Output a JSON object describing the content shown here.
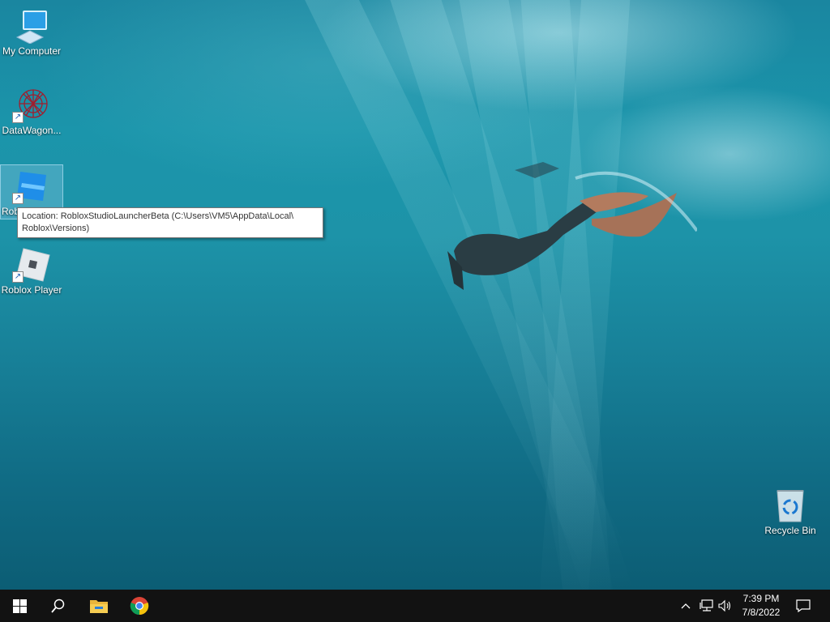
{
  "desktop": {
    "icons": [
      {
        "label": "My Computer",
        "icon": "computer-icon"
      },
      {
        "label": "DataWagon...",
        "icon": "datawagon-icon",
        "shortcut": true
      },
      {
        "label": "Rob",
        "icon": "roblox-studio-icon",
        "shortcut": true,
        "selected": true
      },
      {
        "label": "Roblox Player",
        "icon": "roblox-player-icon",
        "shortcut": true
      },
      {
        "label": "Recycle Bin",
        "icon": "recycle-bin-icon"
      }
    ],
    "tooltip": {
      "line1": "Location: RobloxStudioLauncherBeta (C:\\Users\\VM5\\AppData\\Local\\",
      "line2": "Roblox\\Versions)"
    }
  },
  "taskbar": {
    "start": "windows-start-icon",
    "search": "search-icon",
    "pinned": [
      "file-explorer-icon",
      "chrome-icon"
    ],
    "tray": [
      "chevron-up-icon",
      "network-icon",
      "volume-icon"
    ],
    "clock": {
      "time": "7:39 PM",
      "date": "7/8/2022"
    },
    "notifications": "notification-icon"
  },
  "colors": {
    "taskbar": "#121212",
    "accent": "#1d93a8"
  }
}
